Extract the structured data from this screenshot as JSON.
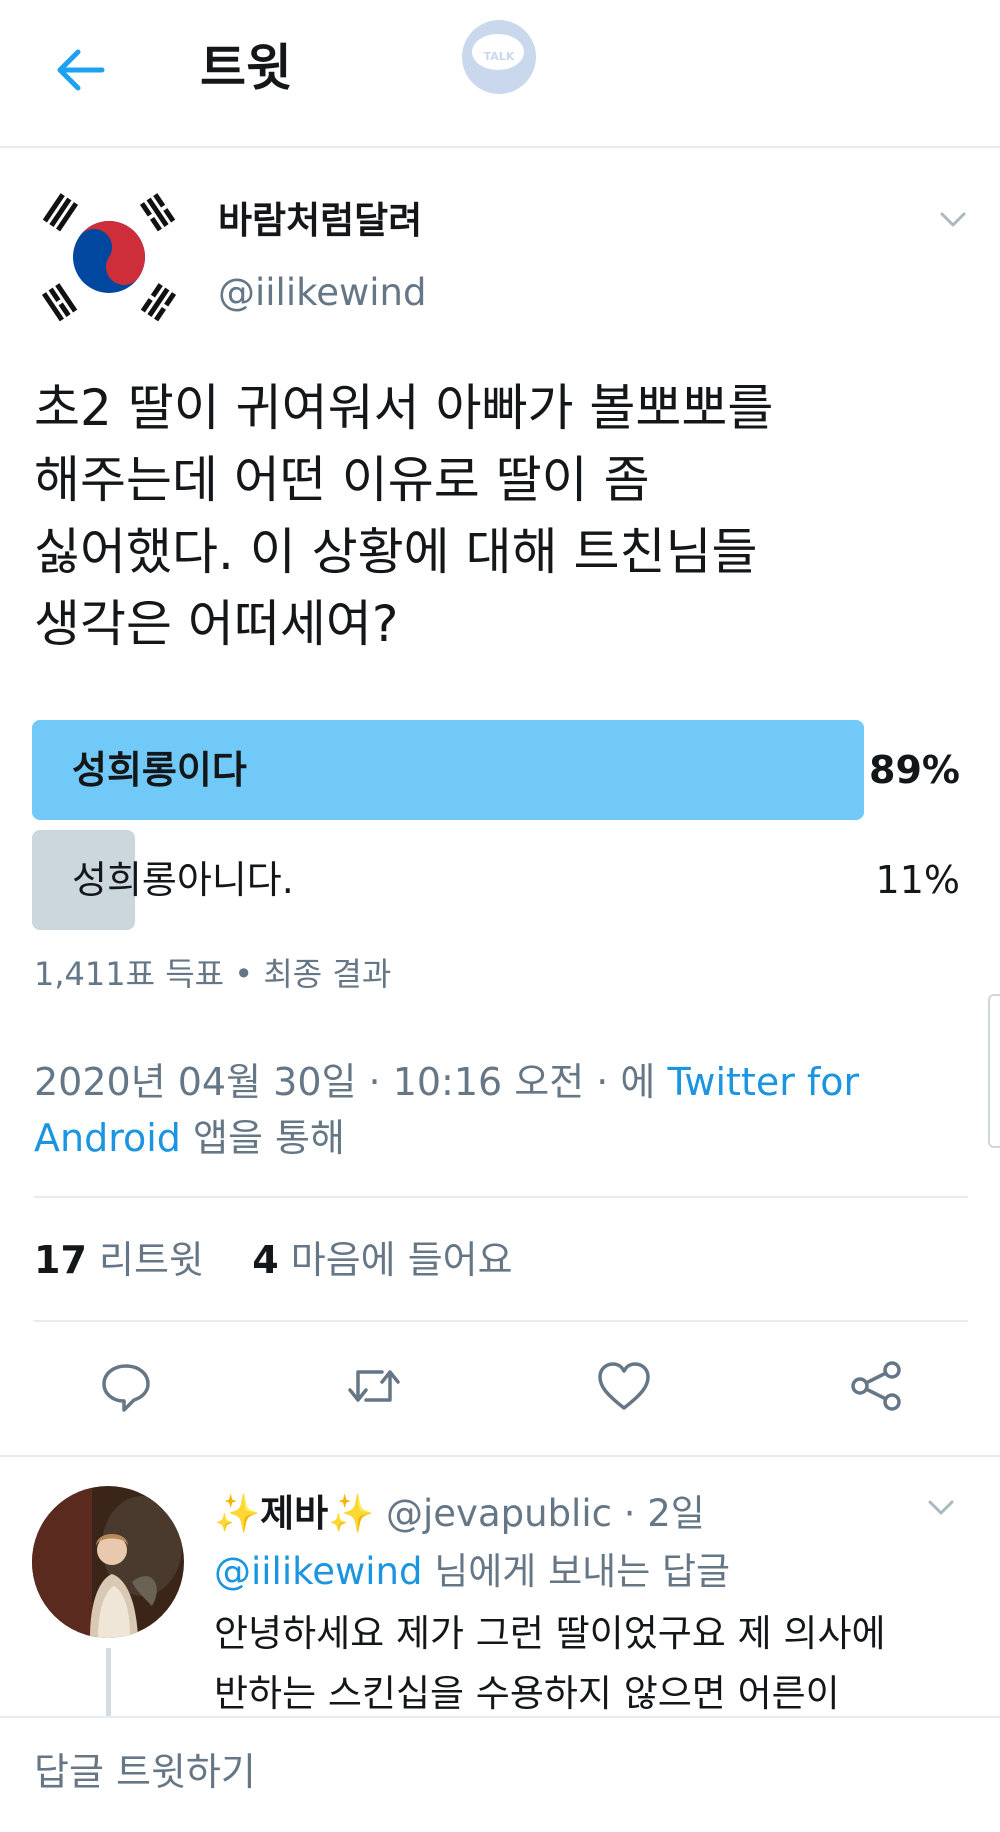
{
  "header": {
    "title": "트윗",
    "back_icon": "arrow-left-icon",
    "talk_label": "TALK"
  },
  "tweet": {
    "author_name": "바람처럼달려",
    "author_handle": "@iilikewind",
    "text_lines": [
      "초2 딸이 귀여워서 아빠가 볼뽀뽀를",
      "해주는데 어떤 이유로 딸이 좀",
      "싫어했다. 이 상황에 대해 트친님들",
      "생각은 어떠세여?"
    ],
    "poll": {
      "options": [
        {
          "label": "성희롱이다",
          "percent_text": "89%",
          "fraction": 0.89,
          "winner": true
        },
        {
          "label": "성희롱아니다.",
          "percent_text": "11%",
          "fraction": 0.11,
          "winner": false
        }
      ],
      "votes": "1,411표 득표",
      "separator": "•",
      "status": "최종 결과"
    },
    "timestamp_pre": "2020년 04월 30일 · 10:16 오전 · 에 ",
    "source_link_1": "Twitter for",
    "source_link_2": "Android",
    "timestamp_post": " 앱을 통해",
    "stats": {
      "retweets_count": "17",
      "retweets_label": "리트윗",
      "likes_count": "4",
      "likes_label": "마음에 들어요"
    },
    "actions": [
      "reply-icon",
      "retweet-icon",
      "like-icon",
      "share-icon"
    ]
  },
  "reply": {
    "sparkle_left": "✨",
    "name": "제바",
    "sparkle_right": "✨",
    "handle": "@jevapublic",
    "time": "· 2일",
    "to_handle": "@iilikewind",
    "to_suffix": " 님에게 보내는 답글",
    "text_lines": [
      "안녕하세요 제가 그런 딸이었구요 제 의사에",
      "반하는 스킨십을 수용하지 않으면 어른이"
    ]
  },
  "compose": {
    "placeholder": "답글 트윗하기"
  },
  "colors": {
    "accent": "#1da1f2",
    "link": "#1b95e0",
    "winner_bar": "#71c9f8",
    "loser_bar": "#ccd6dd",
    "muted_text": "#657786",
    "flag_red": "#cd2e3a",
    "flag_blue": "#0047a0"
  }
}
